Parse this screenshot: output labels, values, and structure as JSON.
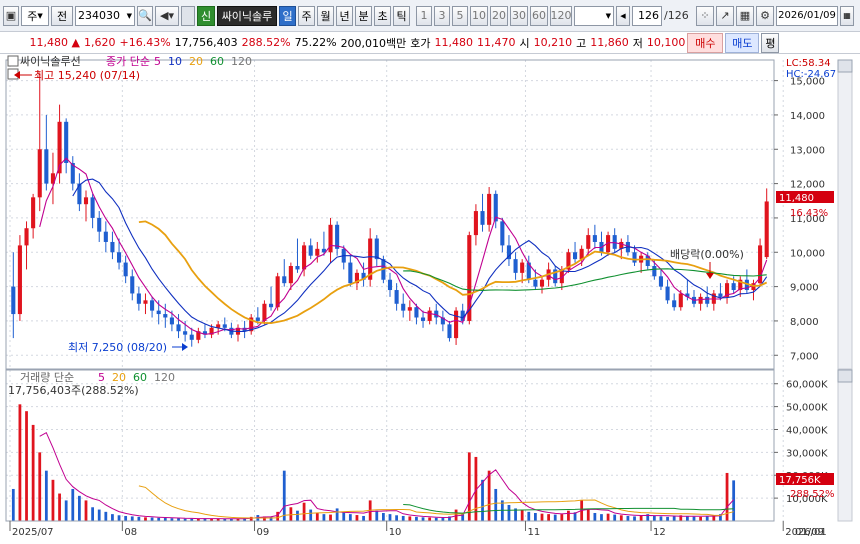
{
  "toolbar": {
    "mode": "주",
    "code": "234030",
    "name_prefix": "전",
    "new_label": "신",
    "stock_name": "싸이닉솔루",
    "periods": [
      "일",
      "주",
      "월",
      "년",
      "분",
      "초",
      "틱"
    ],
    "numbers": [
      "1",
      "3",
      "5",
      "10",
      "20",
      "30",
      "60",
      "120"
    ],
    "count": "126",
    "total": "/126",
    "date": "2026/01/09"
  },
  "info": {
    "price": "11,480",
    "arrow": "▲",
    "change": "1,620",
    "change_pct": "+16.43%",
    "volume": "17,756,403",
    "vol_ratio": "288.52%",
    "turnover": "75.22%",
    "amount": "200,010백만",
    "hoga_label": "호가",
    "ask": "11,480",
    "bid": "11,470",
    "open_label": "시",
    "open": "10,210",
    "high_label": "고",
    "high": "11,860",
    "low_label": "저",
    "low": "10,100",
    "buy": "매수",
    "sell": "매도",
    "eval": "평"
  },
  "chart_data": {
    "type": "candlestick",
    "title": "싸이닉솔루션",
    "price_legend": [
      {
        "name": "종가 단순",
        "value": "5",
        "color": "#c00090"
      },
      {
        "name": "",
        "value": "10",
        "color": "#1030c0"
      },
      {
        "name": "",
        "value": "20",
        "color": "#e8a010"
      },
      {
        "name": "",
        "value": "60",
        "color": "#109030"
      },
      {
        "name": "",
        "value": "120",
        "color": "#777777"
      }
    ],
    "y_ticks": [
      7000,
      8000,
      9000,
      10000,
      11000,
      12000,
      13000,
      14000,
      15000
    ],
    "y_tick_labels": [
      "7,000",
      "8,000",
      "9,000",
      "10,000",
      "11,000",
      "12,000",
      "13,000",
      "14,000",
      "15,000"
    ],
    "ylim": [
      6600,
      15600
    ],
    "lc": "LC:58.34",
    "hc": "HC:-24.67",
    "last_price_label": "11,480",
    "last_pct_label": "16.43%",
    "high_note": "최고 15,240 (07/14)",
    "low_note": "최저 7,250 (08/20)",
    "dividend_note": "배당락(0.00%)",
    "candles": [
      [
        9000,
        10000,
        7500,
        8200
      ],
      [
        8200,
        10500,
        8000,
        10200
      ],
      [
        10200,
        10900,
        9500,
        10700
      ],
      [
        10700,
        11700,
        10400,
        11600
      ],
      [
        11600,
        15240,
        11200,
        13000
      ],
      [
        13000,
        14000,
        11800,
        12000
      ],
      [
        12000,
        12900,
        11400,
        12300
      ],
      [
        12300,
        14300,
        12000,
        13800
      ],
      [
        13800,
        13900,
        12300,
        12600
      ],
      [
        12600,
        12800,
        11800,
        12000
      ],
      [
        12000,
        12300,
        11200,
        11400
      ],
      [
        11400,
        11800,
        10900,
        11600
      ],
      [
        11600,
        11700,
        10700,
        11000
      ],
      [
        11000,
        11200,
        10300,
        10600
      ],
      [
        10600,
        10900,
        10000,
        10300
      ],
      [
        10300,
        10600,
        9800,
        10000
      ],
      [
        10000,
        10400,
        9500,
        9700
      ],
      [
        9700,
        9900,
        9100,
        9300
      ],
      [
        9300,
        9500,
        8600,
        8800
      ],
      [
        8800,
        9000,
        8300,
        8500
      ],
      [
        8500,
        8800,
        8200,
        8600
      ],
      [
        8600,
        8700,
        8100,
        8300
      ],
      [
        8300,
        8600,
        7900,
        8200
      ],
      [
        8200,
        8500,
        7800,
        8100
      ],
      [
        8100,
        8300,
        7700,
        7900
      ],
      [
        7900,
        8200,
        7500,
        7700
      ],
      [
        7700,
        8000,
        7400,
        7600
      ],
      [
        7600,
        7800,
        7250,
        7450
      ],
      [
        7450,
        7800,
        7350,
        7700
      ],
      [
        7700,
        7900,
        7500,
        7600
      ],
      [
        7600,
        7900,
        7500,
        7800
      ],
      [
        7800,
        8000,
        7600,
        7900
      ],
      [
        7900,
        8100,
        7700,
        7800
      ],
      [
        7800,
        7950,
        7500,
        7600
      ],
      [
        7600,
        7900,
        7400,
        7800
      ],
      [
        7800,
        8000,
        7500,
        7700
      ],
      [
        7700,
        8200,
        7600,
        8100
      ],
      [
        8100,
        8400,
        7900,
        8000
      ],
      [
        8000,
        8600,
        7900,
        8500
      ],
      [
        8500,
        9000,
        8300,
        8400
      ],
      [
        8400,
        9400,
        8300,
        9300
      ],
      [
        9300,
        9800,
        9000,
        9100
      ],
      [
        9100,
        9700,
        8900,
        9600
      ],
      [
        9600,
        10400,
        9400,
        9500
      ],
      [
        9500,
        10300,
        9300,
        10200
      ],
      [
        10200,
        10400,
        9800,
        9900
      ],
      [
        9900,
        10300,
        9700,
        10100
      ],
      [
        10100,
        10600,
        9900,
        10000
      ],
      [
        10000,
        11000,
        9700,
        10800
      ],
      [
        10800,
        10900,
        9900,
        10100
      ],
      [
        10100,
        10200,
        9500,
        9700
      ],
      [
        9700,
        9900,
        9000,
        9100
      ],
      [
        9100,
        9500,
        8900,
        9400
      ],
      [
        9400,
        9700,
        9000,
        9200
      ],
      [
        9200,
        10700,
        9000,
        10400
      ],
      [
        10400,
        10500,
        9600,
        9800
      ],
      [
        9800,
        9900,
        9100,
        9200
      ],
      [
        9200,
        9400,
        8700,
        8900
      ],
      [
        8900,
        9100,
        8300,
        8500
      ],
      [
        8500,
        8800,
        8100,
        8300
      ],
      [
        8300,
        8600,
        8000,
        8400
      ],
      [
        8400,
        8500,
        7900,
        8100
      ],
      [
        8100,
        8300,
        7800,
        8000
      ],
      [
        8000,
        8400,
        7900,
        8300
      ],
      [
        8300,
        8500,
        7900,
        8100
      ],
      [
        8100,
        8300,
        7700,
        7900
      ],
      [
        7900,
        8000,
        7400,
        7500
      ],
      [
        7500,
        8400,
        7300,
        8300
      ],
      [
        8300,
        8500,
        7900,
        8000
      ],
      [
        8000,
        10600,
        7900,
        10500
      ],
      [
        10500,
        11400,
        10200,
        11200
      ],
      [
        11200,
        11700,
        10600,
        10800
      ],
      [
        10800,
        11900,
        10600,
        11700
      ],
      [
        11700,
        11800,
        10700,
        10900
      ],
      [
        10900,
        11000,
        10000,
        10200
      ],
      [
        10200,
        10500,
        9600,
        9800
      ],
      [
        9800,
        10000,
        9200,
        9400
      ],
      [
        9400,
        9800,
        9100,
        9700
      ],
      [
        9700,
        9900,
        9100,
        9200
      ],
      [
        9200,
        9500,
        8900,
        9000
      ],
      [
        9000,
        9300,
        8800,
        9200
      ],
      [
        9200,
        9700,
        9000,
        9500
      ],
      [
        9500,
        9600,
        9000,
        9100
      ],
      [
        9100,
        9600,
        8900,
        9500
      ],
      [
        9500,
        10100,
        9400,
        10000
      ],
      [
        10000,
        10300,
        9700,
        9800
      ],
      [
        9800,
        10200,
        9600,
        10100
      ],
      [
        10100,
        10700,
        9900,
        10500
      ],
      [
        10500,
        10800,
        10100,
        10300
      ],
      [
        10300,
        10600,
        9900,
        10000
      ],
      [
        10000,
        10600,
        9900,
        10500
      ],
      [
        10500,
        10700,
        10000,
        10100
      ],
      [
        10100,
        10400,
        9800,
        10300
      ],
      [
        10300,
        10500,
        9900,
        10000
      ],
      [
        10000,
        10200,
        9600,
        9700
      ],
      [
        9700,
        10000,
        9400,
        9900
      ],
      [
        9900,
        10000,
        9500,
        9600
      ],
      [
        9600,
        9800,
        9200,
        9300
      ],
      [
        9300,
        9500,
        8900,
        9000
      ],
      [
        9000,
        9200,
        8500,
        8600
      ],
      [
        8600,
        8800,
        8300,
        8400
      ],
      [
        8400,
        8900,
        8300,
        8800
      ],
      [
        8800,
        9200,
        8600,
        8700
      ],
      [
        8700,
        8900,
        8400,
        8500
      ],
      [
        8500,
        8800,
        8300,
        8700
      ],
      [
        8700,
        9000,
        8400,
        8500
      ],
      [
        8500,
        8900,
        8300,
        8800
      ],
      [
        8800,
        9100,
        8600,
        8700
      ],
      [
        8700,
        9200,
        8500,
        9100
      ],
      [
        9100,
        9300,
        8800,
        8900
      ],
      [
        8900,
        9300,
        8700,
        9200
      ],
      [
        9200,
        9500,
        8800,
        8900
      ],
      [
        8900,
        9200,
        8600,
        9100
      ],
      [
        9100,
        10400,
        9000,
        10200
      ],
      [
        9860,
        11860,
        9800,
        11480
      ]
    ],
    "volume_legend": [
      {
        "name": "거래량 단순",
        "value": "5",
        "color": "#c00090"
      },
      {
        "name": "",
        "value": "20",
        "color": "#e8a010"
      },
      {
        "name": "",
        "value": "60",
        "color": "#109030"
      },
      {
        "name": "",
        "value": "120",
        "color": "#777777"
      }
    ],
    "volume_note": "17,756,403주(288.52%)",
    "vol_ticks": [
      10000,
      20000,
      30000,
      40000,
      50000,
      60000
    ],
    "vol_tick_labels": [
      "10,000K",
      "20,000K",
      "30,000K",
      "40,000K",
      "50,000K",
      "60,000K"
    ],
    "vol_lim": [
      0,
      66000
    ],
    "vol_last_label": "17,756K",
    "vol_pct_label": "288.52%",
    "volumes": [
      14000,
      51000,
      48000,
      42000,
      30000,
      22000,
      18000,
      12000,
      9000,
      14000,
      11000,
      9000,
      6000,
      5000,
      4000,
      3000,
      2500,
      2200,
      2000,
      1800,
      1600,
      1500,
      1400,
      1300,
      1200,
      1100,
      1000,
      1000,
      900,
      1200,
      1100,
      1000,
      900,
      900,
      1000,
      1300,
      1800,
      2600,
      2000,
      1800,
      4000,
      22000,
      6000,
      4500,
      8000,
      5000,
      3500,
      3000,
      2800,
      5500,
      4000,
      3000,
      2600,
      2200,
      9000,
      4500,
      3500,
      3000,
      2500,
      2200,
      2000,
      1800,
      1600,
      1500,
      1400,
      1300,
      2000,
      5000,
      3000,
      30000,
      28000,
      18000,
      22000,
      14000,
      9000,
      7000,
      5500,
      4800,
      4000,
      3500,
      3200,
      3000,
      2800,
      3000,
      4500,
      3800,
      9000,
      5000,
      3500,
      3000,
      3200,
      2800,
      2500,
      2200,
      2000,
      2500,
      3000,
      2200,
      2000,
      1800,
      2000,
      2500,
      2200,
      1900,
      1800,
      2200,
      2500,
      3000,
      21000,
      17756
    ],
    "x_labels": [
      "2025/07",
      "08",
      "09",
      "10",
      "11",
      "12",
      "2026/01",
      "01/09"
    ],
    "x_label_idx": [
      0,
      17,
      37,
      57,
      78,
      97,
      117
    ]
  }
}
